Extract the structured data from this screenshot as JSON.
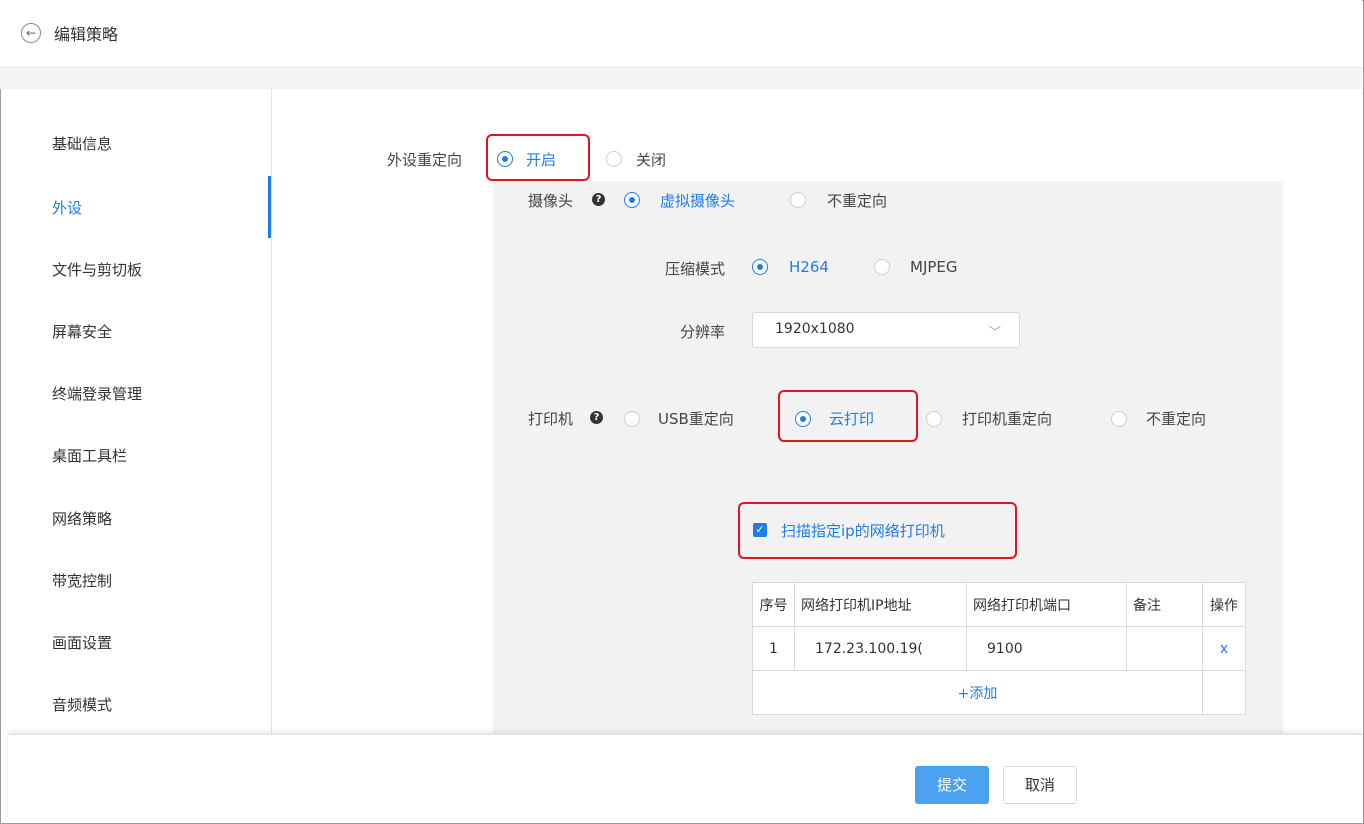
{
  "header": {
    "back_icon": "←",
    "title": "编辑策略"
  },
  "sidebar": {
    "items": [
      {
        "label": "基础信息"
      },
      {
        "label": "外设"
      },
      {
        "label": "文件与剪切板"
      },
      {
        "label": "屏幕安全"
      },
      {
        "label": "终端登录管理"
      },
      {
        "label": "桌面工具栏"
      },
      {
        "label": "网络策略"
      },
      {
        "label": "带宽控制"
      },
      {
        "label": "画面设置"
      },
      {
        "label": "音频模式"
      }
    ],
    "active": "外设"
  },
  "peripheral": {
    "label": "外设重定向",
    "options": [
      "开启",
      "关闭"
    ],
    "selected": "开启"
  },
  "camera": {
    "label": "摄像头",
    "help_icon": "?",
    "options": [
      "虚拟摄像头",
      "不重定向"
    ],
    "selected": "虚拟摄像头",
    "compression": {
      "label": "压缩模式",
      "options": [
        "H264",
        "MJPEG"
      ],
      "selected": "H264"
    },
    "resolution": {
      "label": "分辨率",
      "value": "1920x1080",
      "chevron": "﹀"
    }
  },
  "printer": {
    "label": "打印机",
    "help_icon": "?",
    "options": [
      "USB重定向",
      "云打印",
      "打印机重定向",
      "不重定向"
    ],
    "selected": "云打印",
    "scan_checkbox": {
      "label": "扫描指定ip的网络打印机",
      "checked": true,
      "mark": "✓"
    },
    "table": {
      "headers": [
        "序号",
        "网络打印机IP地址",
        "网络打印机端口",
        "备注",
        "操作"
      ],
      "rows": [
        {
          "index": "1",
          "ip": "172.23.100.19(",
          "port": "9100",
          "note": "",
          "action": "x"
        }
      ],
      "add_label": "+添加"
    }
  },
  "footer": {
    "submit": "提交",
    "cancel": "取消"
  },
  "colors": {
    "accent": "#1e7ee8",
    "highlight": "#e0141e",
    "panel": "#f2f2f2",
    "submit": "#4ba0f0"
  }
}
